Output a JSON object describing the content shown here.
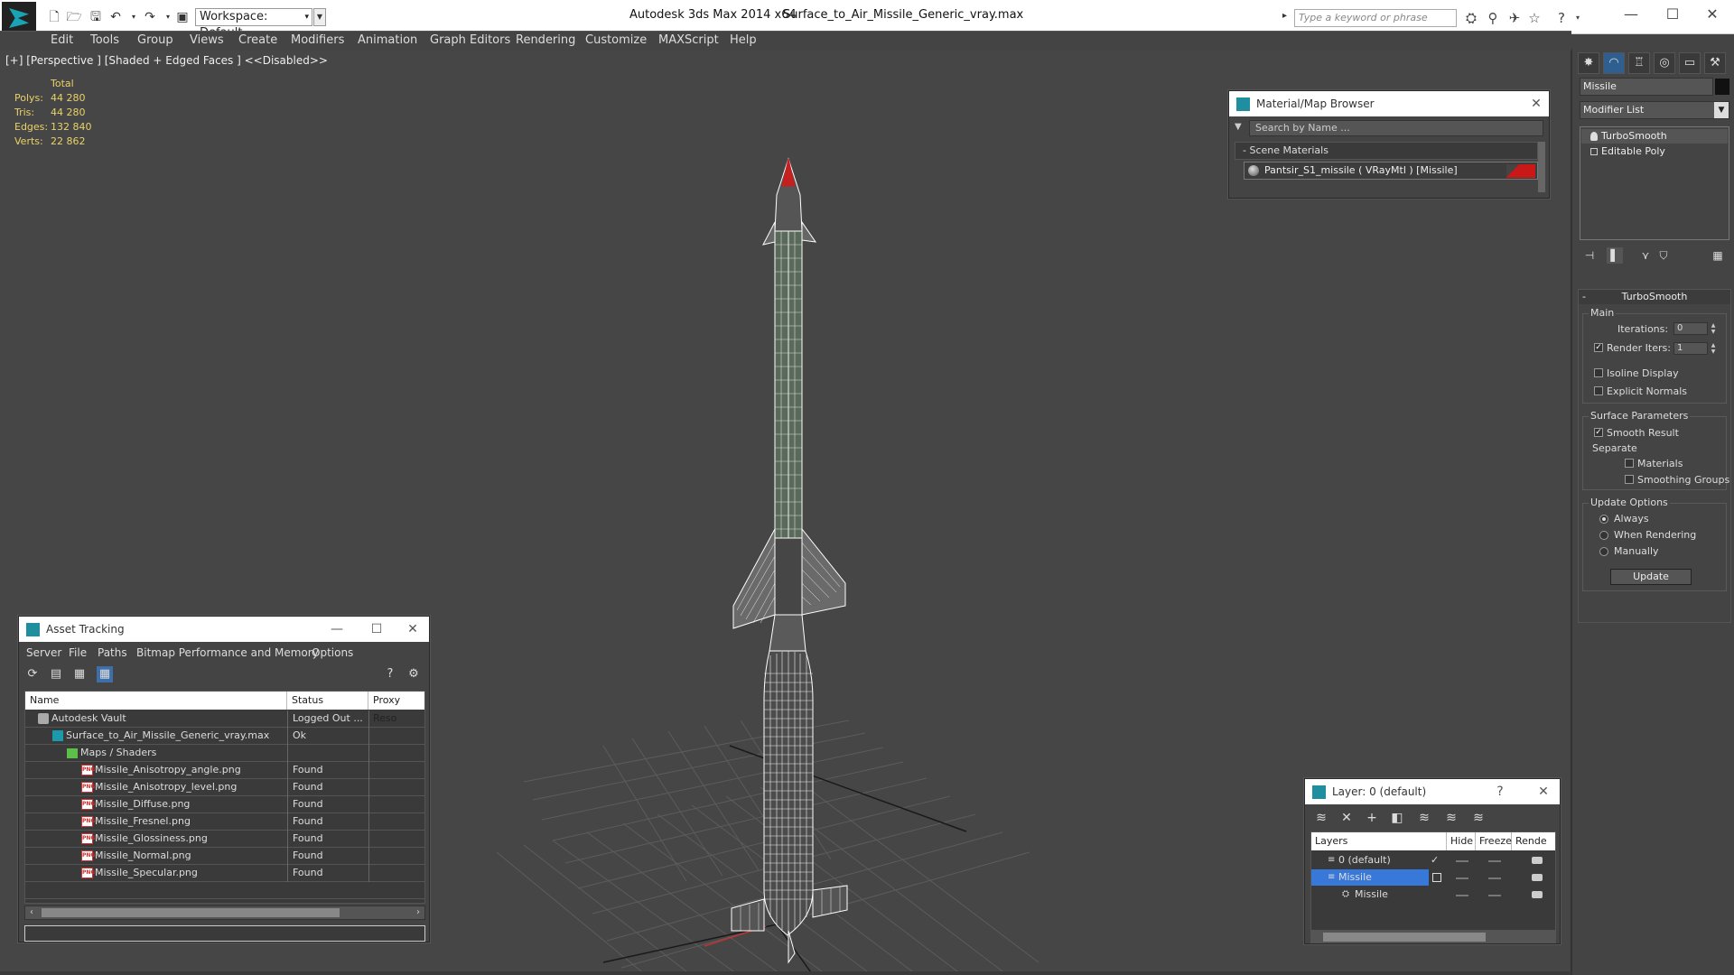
{
  "titlebar": {
    "workspace": "Workspace: Default",
    "app_title": "Autodesk 3ds Max  2014 x64",
    "file_title": "Surface_to_Air_Missile_Generic_vray.max",
    "search_placeholder": "Type a keyword or phrase"
  },
  "menubar": {
    "items": [
      "Edit",
      "Tools",
      "Group",
      "Views",
      "Create",
      "Modifiers",
      "Animation",
      "Graph Editors",
      "Rendering",
      "Customize",
      "MAXScript",
      "Help"
    ]
  },
  "viewport": {
    "label": "[+] [Perspective ] [Shaded + Edged Faces ]  <<Disabled>>",
    "stats": {
      "header": "Total",
      "rows": [
        {
          "key": "Polys:",
          "value": "44 280"
        },
        {
          "key": "Tris:",
          "value": "44 280"
        },
        {
          "key": "Edges:",
          "value": "132 840"
        },
        {
          "key": "Verts:",
          "value": "22 862"
        }
      ]
    }
  },
  "material_browser": {
    "title": "Material/Map Browser",
    "search_placeholder": "Search by Name ...",
    "section": "Scene Materials",
    "section_toggle": "-",
    "item": "Pantsir_S1_missile  ( VRayMtl )  [Missile]",
    "swatch_color": "#c81818"
  },
  "asset_tracking": {
    "title": "Asset Tracking",
    "menu": [
      "Server",
      "File",
      "Paths",
      "Bitmap Performance and Memory",
      "Options"
    ],
    "columns": [
      "Name",
      "Status",
      "Proxy Reso"
    ],
    "rows": [
      {
        "name": "Autodesk Vault",
        "status": "Logged Out ...",
        "icon": "vault-icon",
        "indent": 1
      },
      {
        "name": "Surface_to_Air_Missile_Generic_vray.max",
        "status": "Ok",
        "icon": "max-file-icon",
        "indent": 2
      },
      {
        "name": "Maps / Shaders",
        "status": "",
        "icon": "folder-icon",
        "indent": 3
      },
      {
        "name": "Missile_Anisotropy_angle.png",
        "status": "Found",
        "icon": "png-icon",
        "indent": 4
      },
      {
        "name": "Missile_Anisotropy_level.png",
        "status": "Found",
        "icon": "png-icon",
        "indent": 4
      },
      {
        "name": "Missile_Diffuse.png",
        "status": "Found",
        "icon": "png-icon",
        "indent": 4
      },
      {
        "name": "Missile_Fresnel.png",
        "status": "Found",
        "icon": "png-icon",
        "indent": 4
      },
      {
        "name": "Missile_Glossiness.png",
        "status": "Found",
        "icon": "png-icon",
        "indent": 4
      },
      {
        "name": "Missile_Normal.png",
        "status": "Found",
        "icon": "png-icon",
        "indent": 4
      },
      {
        "name": "Missile_Specular.png",
        "status": "Found",
        "icon": "png-icon",
        "indent": 4
      }
    ]
  },
  "layer_window": {
    "title": "Layer: 0 (default)",
    "help": "?",
    "columns": [
      "Layers",
      "Hide",
      "Freeze",
      "Rende"
    ],
    "rows": [
      {
        "name": "0 (default)",
        "selected": false
      },
      {
        "name": "Missile",
        "selected": true
      },
      {
        "name": "Missile",
        "selected": false
      }
    ]
  },
  "command_panel": {
    "object_name": "Missile",
    "object_color": "#111111",
    "modifier_list": "Modifier List",
    "stack": [
      "TurboSmooth",
      "Editable Poly"
    ],
    "turbosmooth": {
      "title": "TurboSmooth",
      "toggle": "-",
      "main_label": "Main",
      "iterations_label": "Iterations:",
      "iterations_value": "0",
      "render_iters_label": "Render Iters:",
      "render_iters_value": "1",
      "render_iters_checked": true,
      "isoline_label": "Isoline Display",
      "explicit_normals_label": "Explicit Normals",
      "surface_params_label": "Surface Parameters",
      "smooth_result_label": "Smooth Result",
      "smooth_result_checked": true,
      "separate_label": "Separate",
      "materials_label": "Materials",
      "smoothing_groups_label": "Smoothing Groups",
      "update_options_label": "Update Options",
      "always_label": "Always",
      "when_rendering_label": "When Rendering",
      "manually_label": "Manually",
      "update_selected": "Always",
      "update_button": "Update"
    }
  }
}
